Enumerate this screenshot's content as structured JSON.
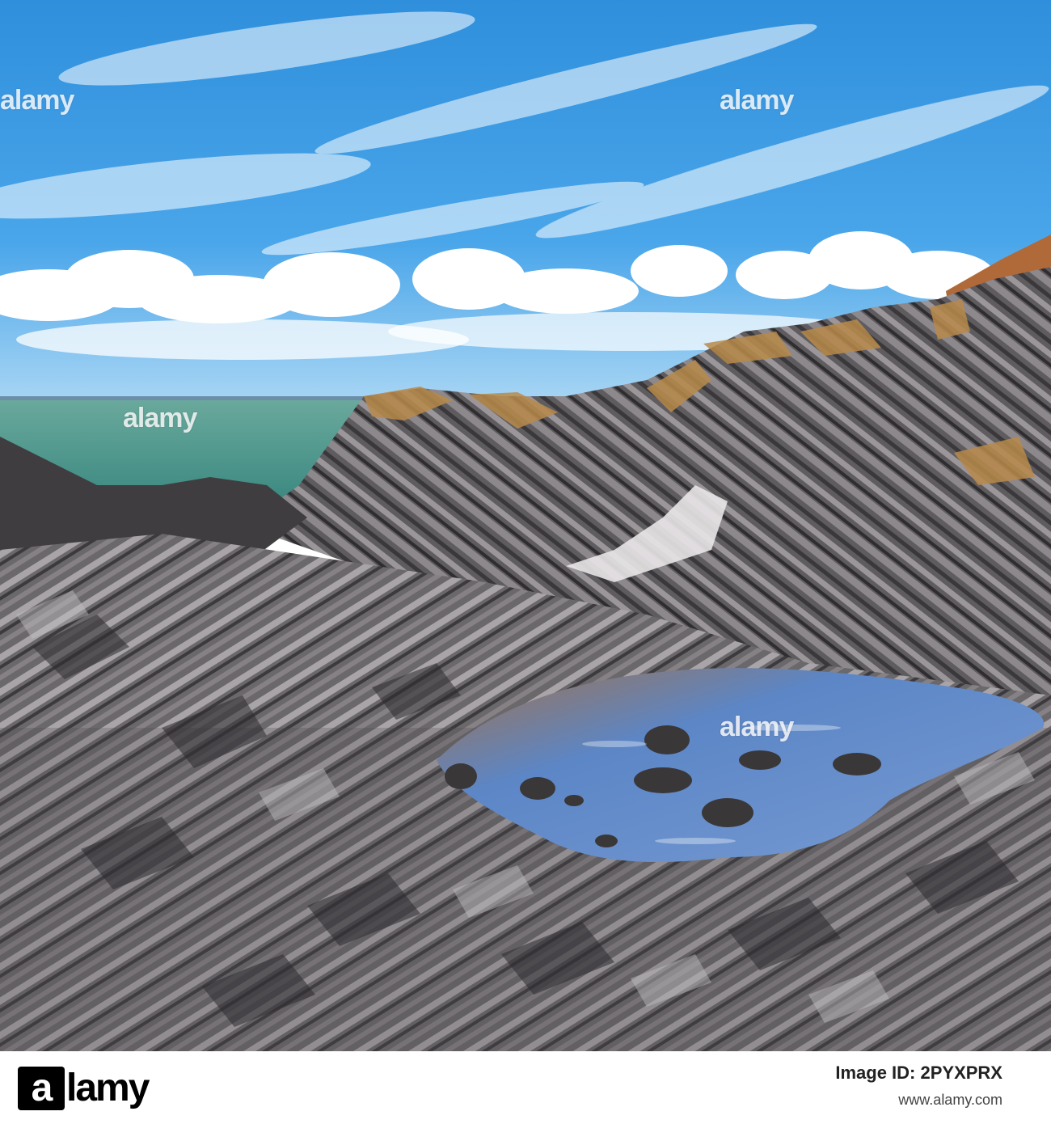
{
  "image": {
    "watermark_text": "alamy",
    "colors": {
      "sky": "#3b9ae0",
      "sky_light": "#9fd0f5",
      "cloud": "#ffffff",
      "sea": "#4e9a8e",
      "rock_dark": "#3c3a3c",
      "rock_mid": "#6d6a6e",
      "rock_light": "#b7b3b6",
      "lichen": "#b88a4a",
      "pool": "#5a86c8",
      "pool_brown": "#a0714b"
    }
  },
  "footer": {
    "logo": "alamy",
    "logo_a": "a",
    "image_id": "Image ID: 2PYXPRX",
    "site": "www.alamy.com"
  }
}
